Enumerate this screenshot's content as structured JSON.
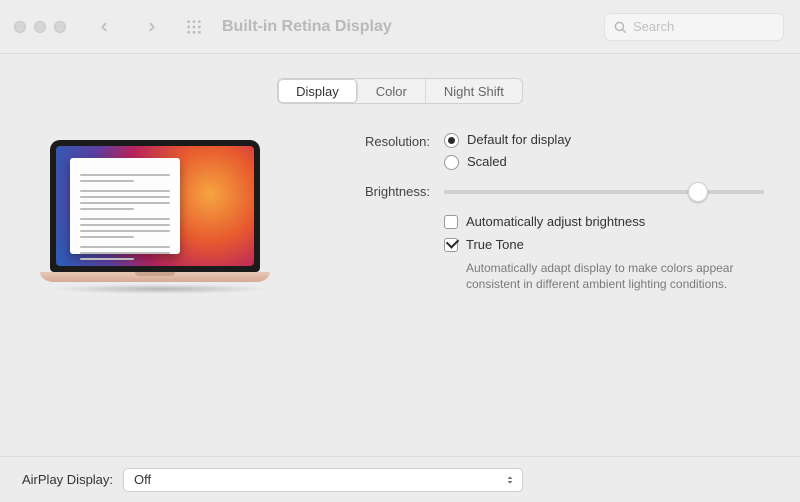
{
  "window": {
    "title": "Built-in Retina Display",
    "search_placeholder": "Search"
  },
  "tabs": {
    "display": "Display",
    "color": "Color",
    "night_shift": "Night Shift",
    "active": "display"
  },
  "settings": {
    "resolution_label": "Resolution:",
    "resolution_options": {
      "default": "Default for display",
      "scaled": "Scaled"
    },
    "resolution_selected": "default",
    "brightness_label": "Brightness:",
    "brightness_value": 78,
    "auto_brightness": {
      "label": "Automatically adjust brightness",
      "checked": false
    },
    "true_tone": {
      "label": "True Tone",
      "checked": true,
      "description": "Automatically adapt display to make colors appear consistent in different ambient lighting conditions."
    }
  },
  "airplay": {
    "label": "AirPlay Display:",
    "value": "Off"
  }
}
